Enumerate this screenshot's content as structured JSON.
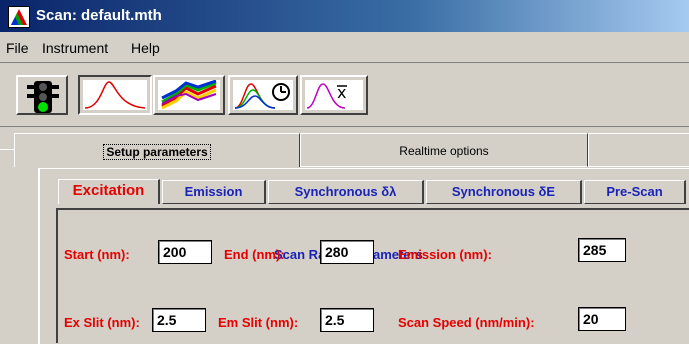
{
  "window": {
    "title": "Scan: default.mth"
  },
  "menu": {
    "items": [
      "File",
      "Instrument",
      "Help"
    ]
  },
  "toolbar": {
    "buttons": [
      {
        "icon": "traffic-light-icon"
      },
      {
        "icon": "single-peak-spectrum-icon",
        "pressed": true
      },
      {
        "icon": "multi-spectrum-icon"
      },
      {
        "icon": "time-scan-icon"
      },
      {
        "icon": "peak-average-icon"
      }
    ]
  },
  "tabs": {
    "setup": "Setup parameters",
    "realtime": "Realtime options"
  },
  "subtabs": {
    "excitation": "Excitation",
    "emission": "Emission",
    "sync_lambda": "Synchronous δλ",
    "sync_e": "Synchronous δE",
    "prescan": "Pre-Scan"
  },
  "panel": {
    "title": "Scan Range Parameters",
    "start_label": "Start (nm):",
    "start_value": "200",
    "end_label": "End (nm):",
    "end_value": "280",
    "emission_label": "Emission (nm):",
    "emission_value": "285",
    "exslit_label": "Ex Slit (nm):",
    "exslit_value": "2.5",
    "emslit_label": "Em Slit (nm):",
    "emslit_value": "2.5",
    "speed_label": "Scan Speed (nm/min):",
    "speed_value": "20"
  },
  "colors": {
    "label_red": "#e60000",
    "label_blue": "#1a23b8",
    "title_blue": "#0a246a"
  }
}
